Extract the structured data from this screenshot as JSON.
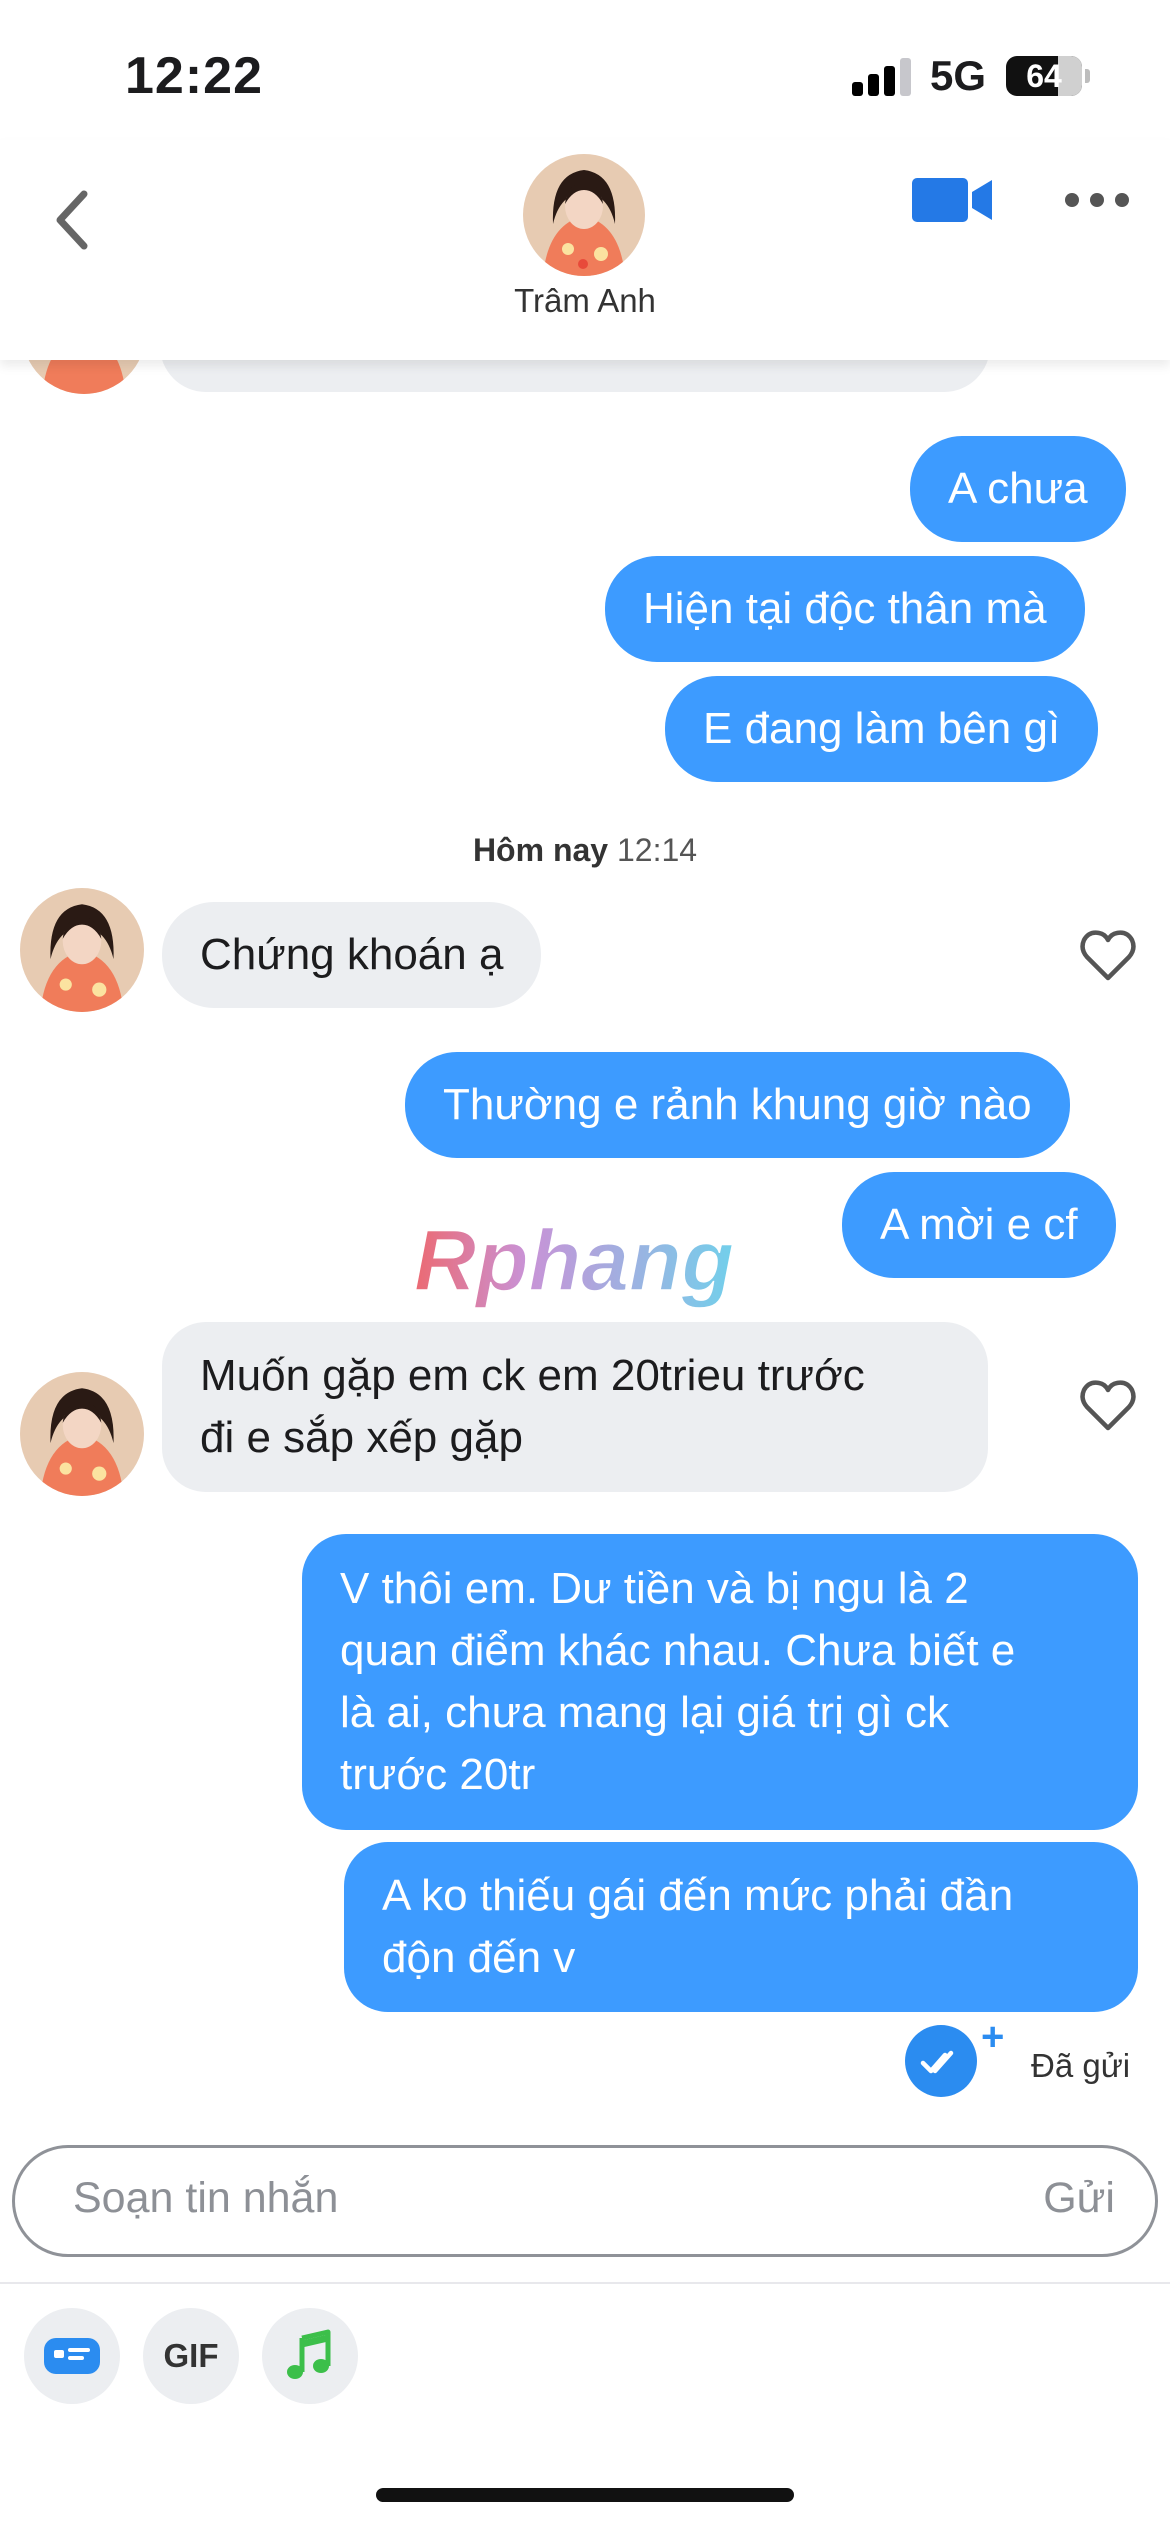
{
  "status_bar": {
    "time": "12:22",
    "network": "5G",
    "battery": "64"
  },
  "header": {
    "contact_name": "Trâm Anh"
  },
  "date_separator": {
    "day": "Hôm nay",
    "time": "12:14"
  },
  "messages": [
    {
      "from": "me",
      "text": "A chưa"
    },
    {
      "from": "me",
      "text": "Hiện tại độc thân mà"
    },
    {
      "from": "me",
      "text": "E đang làm bên gì"
    },
    {
      "from": "contact",
      "text": "Chứng khoán ạ"
    },
    {
      "from": "me",
      "text": "Thường e rảnh khung giờ nào"
    },
    {
      "from": "me",
      "text": "A mời e cf"
    },
    {
      "from": "contact",
      "lines": [
        "Muốn gặp em ck em 20trieu trước",
        "đi e sắp xếp gặp"
      ]
    },
    {
      "from": "me",
      "lines": [
        "V thôi em. Dư tiền và bị ngu là 2",
        "quan điểm khác nhau. Chưa biết e",
        "là ai, chưa mang lại giá trị gì ck",
        "trước 20tr"
      ]
    },
    {
      "from": "me",
      "lines": [
        "A ko thiếu gái đến mức phải đần",
        "độn đến v"
      ]
    }
  ],
  "sent_status": {
    "label": "Đã gửi"
  },
  "composer": {
    "placeholder": "Soạn tin nhắn",
    "send_label": "Gửi"
  },
  "toolbar": {
    "gif_label": "GIF"
  },
  "watermark": {
    "text": "Rphang"
  },
  "colors": {
    "sent_bubble": "#3d9bff",
    "received_bubble": "#eceef1",
    "accent": "#2b8cf0"
  }
}
